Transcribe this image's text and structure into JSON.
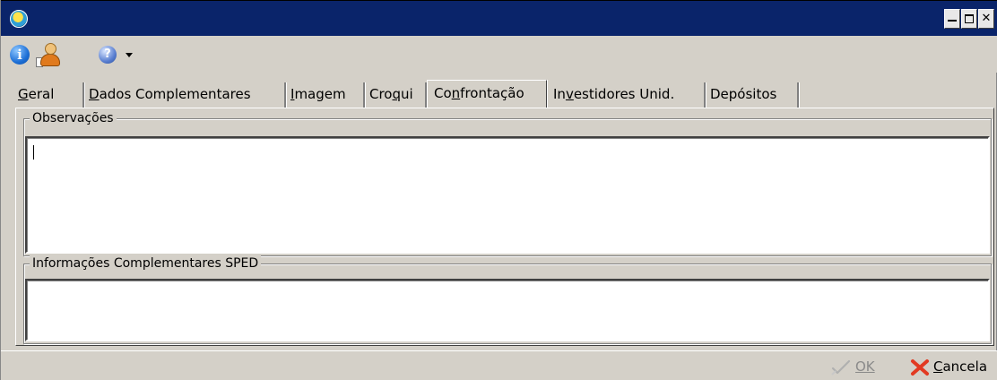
{
  "window": {
    "icon": "app-icon",
    "controls": [
      "minimize-icon",
      "maximize-icon",
      "close-icon"
    ]
  },
  "toolbar": {
    "items": [
      "info-icon",
      "user-icon",
      "help-icon",
      "chevron-down-icon"
    ]
  },
  "tabs": [
    {
      "label": "Geral",
      "mnemonic_index": 0,
      "active": false
    },
    {
      "label": "Dados Complementares",
      "mnemonic_index": 0,
      "active": false
    },
    {
      "label": "Imagem",
      "mnemonic_index": 0,
      "active": false
    },
    {
      "label": "Croqui",
      "mnemonic_index": 3,
      "active": false
    },
    {
      "label": "Confrontação",
      "mnemonic_index": 2,
      "active": true
    },
    {
      "label": "Investidores Unid.",
      "mnemonic_index": 2,
      "active": false
    },
    {
      "label": "Depósitos",
      "mnemonic_index": -1,
      "active": false
    }
  ],
  "observacoes": {
    "legend": "Observações",
    "value": ""
  },
  "sped": {
    "legend": "Informações Complementares SPED",
    "value": ""
  },
  "buttons": {
    "ok_label": "OK",
    "ok_enabled": false,
    "cancel_label": "Cancela"
  },
  "colors": {
    "titlebar": "#0a246a",
    "face": "#d4d0c8",
    "cancel_x": "#e23a22",
    "disabled_text": "#8a8a8a"
  }
}
